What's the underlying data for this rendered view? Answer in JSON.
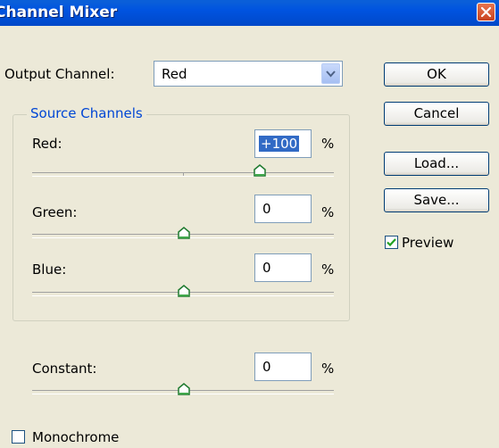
{
  "window": {
    "title": "Channel Mixer"
  },
  "output_channel": {
    "label": "Output Channel:",
    "value": "Red"
  },
  "source_channels": {
    "title": "Source Channels",
    "red": {
      "label": "Red:",
      "value": "+100",
      "unit": "%",
      "level": 100
    },
    "green": {
      "label": "Green:",
      "value": "0",
      "unit": "%",
      "level": 0
    },
    "blue": {
      "label": "Blue:",
      "value": "0",
      "unit": "%",
      "level": 0
    }
  },
  "constant": {
    "label": "Constant:",
    "value": "0",
    "unit": "%",
    "level": 0
  },
  "monochrome": {
    "label": "Monochrome",
    "checked": false
  },
  "buttons": {
    "ok": "OK",
    "cancel": "Cancel",
    "load": "Load...",
    "save": "Save..."
  },
  "preview": {
    "label": "Preview",
    "checked": true
  },
  "icons": [
    "close-icon",
    "chevron-down-icon",
    "slider-thumb-icon",
    "checkmark-icon"
  ]
}
